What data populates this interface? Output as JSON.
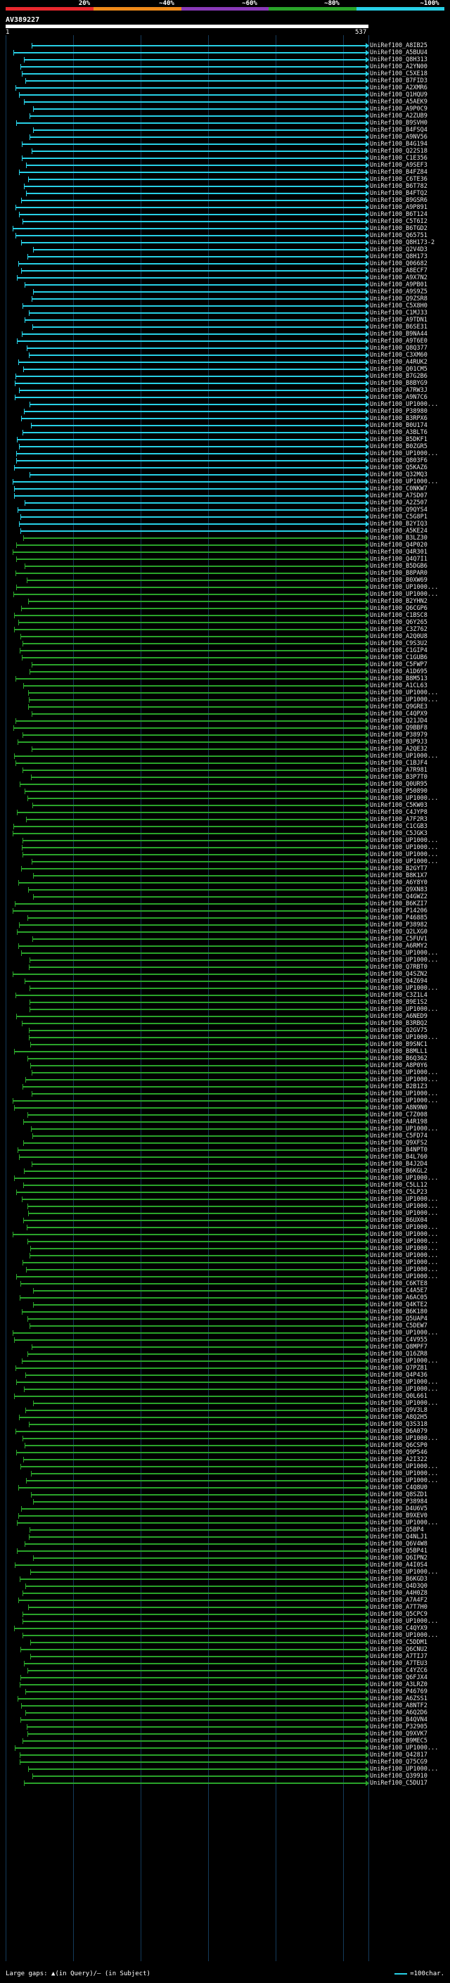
{
  "legend": {
    "labels": [
      "20%",
      "~40%",
      "~60%",
      "~80%",
      "~100%"
    ],
    "colors": [
      "#e8282e",
      "#ee8a1a",
      "#8a3ab8",
      "#2aa32a",
      "#28d0e6"
    ]
  },
  "query": {
    "title": "AV389227",
    "start": "1",
    "end": "537"
  },
  "colors": {
    "high": "#28d0e6",
    "mid": "#2aa32a",
    "grid": "#143a5a"
  },
  "footer": {
    "gaps_text": "Large gaps: ▲(in Query)/– (in Subject)",
    "scale_text": "=100char."
  },
  "hits": [
    "UniRef100_A8IB25",
    "UniRef100_A5BUU4",
    "UniRef100_Q8H313",
    "UniRef100_A2YN00",
    "UniRef100_C5XE18",
    "UniRef100_B7FID3",
    "UniRef100_A2XMR6",
    "UniRef100_Q1HQU9",
    "UniRef100_A5AEK9",
    "UniRef100_A9P0C9",
    "UniRef100_A2ZUB9",
    "UniRef100_B9SVH0",
    "UniRef100_B4FSQ4",
    "UniRef100_A9NV56",
    "UniRef100_B4G194",
    "UniRef100_Q22S18",
    "UniRef100_C1E356",
    "UniRef100_A9SEF3",
    "UniRef100_B4FZ84",
    "UniRef100_C6TE36",
    "UniRef100_B6T782",
    "UniRef100_B4FTQ2",
    "UniRef100_B9GSR6",
    "UniRef100_A9P891",
    "UniRef100_B6T124",
    "UniRef100_C5T6I2",
    "UniRef100_B6TGD2",
    "UniRef100_Q65751",
    "UniRef100_Q8H173-2",
    "UniRef100_Q2V4D3",
    "UniRef100_Q8H173",
    "UniRef100_Q06682",
    "UniRef100_A8ECF7",
    "UniRef100_A9X7N2",
    "UniRef100_A9PB01",
    "UniRef100_A9S9Z5",
    "UniRef100_Q9ZSR8",
    "UniRef100_C5X8H0",
    "UniRef100_C1MJ33",
    "UniRef100_A9TDN1",
    "UniRef100_B6SE31",
    "UniRef100_B9NA44",
    "UniRef100_A9T6E0",
    "UniRef100_Q8Q377",
    "UniRef100_C3XM60",
    "UniRef100_A4RUK2",
    "UniRef100_Q01CM5",
    "UniRef100_B7G2B6",
    "UniRef100_B8BYG9",
    "UniRef100_A7RW3J",
    "UniRef100_A9N7C6",
    "UniRef100_UP1000...",
    "UniRef100_P38980",
    "UniRef100_B3RPX6",
    "UniRef100_B0U174",
    "UniRef100_A3BLT6",
    "UniRef100_B5DKF1",
    "UniRef100_B0ZGR5",
    "UniRef100_UP1000...",
    "UniRef100_Q803F6",
    "UniRef100_Q5KAZ6",
    "UniRef100_Q32MQ3",
    "UniRef100_UP1000...",
    "UniRef100_C0NKW7",
    "UniRef100_A7SD07",
    "UniRef100_A2Z507",
    "UniRef100_Q9QYS4",
    "UniRef100_C5G8P1",
    "UniRef100_B2YIQ3",
    "UniRef100_A5KE24",
    "UniRef100_B3LZ30",
    "UniRef100_Q4P020",
    "UniRef100_Q4R301",
    "UniRef100_Q4Q7I1",
    "UniRef100_B5DGB6",
    "UniRef100_B8PAR0",
    "UniRef100_B0XW69",
    "UniRef100_UP1000...",
    "UniRef100_UP1000...",
    "UniRef100_B2YHN2",
    "UniRef100_Q6CGP6",
    "UniRef100_C1BSC8",
    "UniRef100_Q6Y265",
    "UniRef100_C3Z762",
    "UniRef100_A2Q0U8",
    "UniRef100_C9S3U2",
    "UniRef100_C1GIP4",
    "UniRef100_C1GUB6",
    "UniRef100_C5FWP7",
    "UniRef100_A1D695",
    "UniRef100_B8M513",
    "UniRef100_A1CL63",
    "UniRef100_UP1000...",
    "UniRef100_UP1000...",
    "UniRef100_Q9GRE3",
    "UniRef100_C4QPX9",
    "UniRef100_Q21JD4",
    "UniRef100_Q9BBF8",
    "UniRef100_P38979",
    "UniRef100_B3P9J3",
    "UniRef100_A2QE32",
    "UniRef100_UP1000...",
    "UniRef100_C1BJF4",
    "UniRef100_A7R981",
    "UniRef100_B3P7T0",
    "UniRef100_Q0UR95",
    "UniRef100_P50890",
    "UniRef100_UP1000...",
    "UniRef100_C5KW03",
    "UniRef100_C4JYP8",
    "UniRef100_A7F2R3",
    "UniRef100_C1CGB3",
    "UniRef100_C5JGK3",
    "UniRef100_UP1000...",
    "UniRef100_UP1000...",
    "UniRef100_UP1000...",
    "UniRef100_UP1000...",
    "UniRef100_B2GYT7",
    "UniRef100_B8K1X7",
    "UniRef100_A6Y8Y0",
    "UniRef100_Q9XN83",
    "UniRef100_Q4GWZ2",
    "UniRef100_B6KZI7",
    "UniRef100_P14206",
    "UniRef100_P46885",
    "UniRef100_P38982",
    "UniRef100_Q2LXG0",
    "UniRef100_C5FUV1",
    "UniRef100_A6RMY2",
    "UniRef100_UP1000...",
    "UniRef100_UP1000...",
    "UniRef100_Q7RBT0",
    "UniRef100_Q4SZN2",
    "UniRef100_Q4Z694",
    "UniRef100_UP1000...",
    "UniRef100_C3Z1L4",
    "UniRef100_B9E1S2",
    "UniRef100_UP1000...",
    "UniRef100_A6NED9",
    "UniRef100_B3RBQ2",
    "UniRef100_Q2GV75",
    "UniRef100_UP1000...",
    "UniRef100_B9SNC1",
    "UniRef100_B8MLL1",
    "UniRef100_B6Q362",
    "UniRef100_A8P0Y6",
    "UniRef100_UP1000...",
    "UniRef100_UP1000...",
    "UniRef100_B2B1Z3",
    "UniRef100_UP1000...",
    "UniRef100_UP1000...",
    "UniRef100_A8N9N0",
    "UniRef100_C7Z008",
    "UniRef100_A4R198",
    "UniRef100_UP1000...",
    "UniRef100_C5FD74",
    "UniRef100_Q9XFS2",
    "UniRef100_B4NPT0",
    "UniRef100_B4L760",
    "UniRef100_B4J2D4",
    "UniRef100_B6KGL2",
    "UniRef100_UP1000...",
    "UniRef100_C5LL12",
    "UniRef100_C5LP23",
    "UniRef100_UP1000...",
    "UniRef100_UP1000...",
    "UniRef100_UP1000...",
    "UniRef100_B6UX04",
    "UniRef100_UP1000...",
    "UniRef100_UP1000...",
    "UniRef100_UP1000...",
    "UniRef100_UP1000...",
    "UniRef100_UP1000...",
    "UniRef100_UP1000...",
    "UniRef100_UP1000...",
    "UniRef100_UP1000...",
    "UniRef100_C6KTE8",
    "UniRef100_C4A5E7",
    "UniRef100_A6AC05",
    "UniRef100_Q4KTE2",
    "UniRef100_B6K180",
    "UniRef100_Q5UAP4",
    "UniRef100_C5DEW7",
    "UniRef100_UP1000...",
    "UniRef100_C4V955",
    "UniRef100_Q8MPF7",
    "UniRef100_Q16ZR8",
    "UniRef100_UP1000...",
    "UniRef100_Q7PZ81",
    "UniRef100_Q4P436",
    "UniRef100_UP1000...",
    "UniRef100_UP1000...",
    "UniRef100_Q0L661",
    "UniRef100_UP1000...",
    "UniRef100_Q9V3L8",
    "UniRef100_A8Q2H5",
    "UniRef100_Q3S318",
    "UniRef100_D6A079",
    "UniRef100_UP1000...",
    "UniRef100_Q6CSP0",
    "UniRef100_Q9P546",
    "UniRef100_A2I322",
    "UniRef100_UP1000...",
    "UniRef100_UP1000...",
    "UniRef100_UP1000...",
    "UniRef100_C4Q8U0",
    "UniRef100_Q8SZD1",
    "UniRef100_P38984",
    "UniRef100_D4U6V5",
    "UniRef100_B9XEV0",
    "UniRef100_UP1000...",
    "UniRef100_Q5BP4",
    "UniRef100_Q4NLJ1",
    "UniRef100_Q6V4W8",
    "UniRef100_Q5BP41",
    "UniRef100_Q6IPN2",
    "UniRef100_A4I0S4",
    "UniRef100_UP1000...",
    "UniRef100_B6KGD3",
    "UniRef100_Q4D3Q0",
    "UniRef100_A4H0Z8",
    "UniRef100_A7A4F2",
    "UniRef100_A7T7H0",
    "UniRef100_Q5CPC9",
    "UniRef100_UP1000...",
    "UniRef100_C4QYX9",
    "UniRef100_UP1000...",
    "UniRef100_C5DDM1",
    "UniRef100_Q6CNU2",
    "UniRef100_A7TIJ7",
    "UniRef100_A7TEU3",
    "UniRef100_C4YZC6",
    "UniRef100_Q6FJX4",
    "UniRef100_A3LRZ0",
    "UniRef100_P46769",
    "UniRef100_A6ZSS1",
    "UniRef100_A8NTF2",
    "UniRef100_A6Q2D6",
    "UniRef100_B4QVN4",
    "UniRef100_P32905",
    "UniRef100_Q9XVK7",
    "UniRef100_B9MEC5",
    "UniRef100_UP1000...",
    "UniRef100_Q42817",
    "UniRef100_Q75CG9",
    "UniRef100_UP1000...",
    "UniRef100_Q39910",
    "UniRef100_C5DU17"
  ]
}
